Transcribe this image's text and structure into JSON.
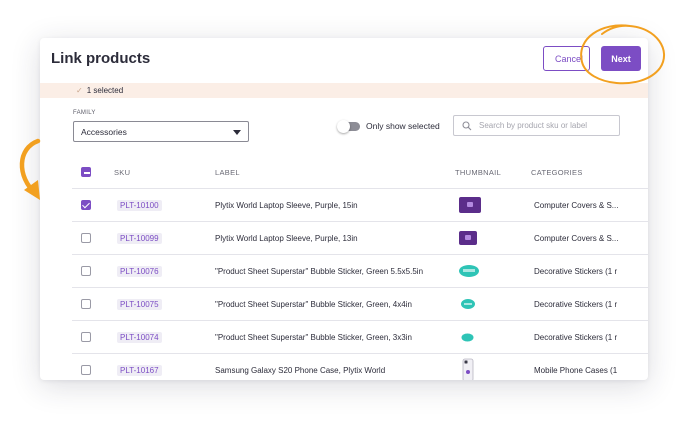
{
  "modal": {
    "title": "Link products",
    "cancel_label": "Cancel",
    "next_label": "Next",
    "selected_text": "1 selected"
  },
  "filters": {
    "family_label": "FAMILY",
    "family_value": "Accessories",
    "toggle_label": "Only show selected",
    "toggle_on": false,
    "search_placeholder": "Search by product sku or label"
  },
  "table": {
    "columns": [
      "SKU",
      "LABEL",
      "THUMBNAIL",
      "CATEGORIES"
    ],
    "rows": [
      {
        "sku": "PLT-10100",
        "label": "Plytix World Laptop Sleeve, Purple, 15in",
        "category": "Computer Covers & S...",
        "checked": true,
        "thumb": "laptop-sleeve"
      },
      {
        "sku": "PLT-10099",
        "label": "Plytix World Laptop Sleeve, Purple, 13in",
        "category": "Computer Covers & S...",
        "checked": false,
        "thumb": "laptop-sleeve"
      },
      {
        "sku": "PLT-10076",
        "label": "\"Product Sheet Superstar\" Bubble Sticker, Green 5.5x5.5in",
        "category": "Decorative Stickers (1 r",
        "checked": false,
        "thumb": "bubble-sticker"
      },
      {
        "sku": "PLT-10075",
        "label": "\"Product Sheet Superstar\" Bubble Sticker, Green, 4x4in",
        "category": "Decorative Stickers (1 r",
        "checked": false,
        "thumb": "bubble-sticker"
      },
      {
        "sku": "PLT-10074",
        "label": "\"Product Sheet Superstar\" Bubble Sticker, Green, 3x3in",
        "category": "Decorative Stickers (1 r",
        "checked": false,
        "thumb": "bubble-sticker"
      },
      {
        "sku": "PLT-10167",
        "label": "Samsung Galaxy S20 Phone Case, Plytix World",
        "category": "Mobile Phone Cases (1",
        "checked": false,
        "thumb": "phone-case"
      }
    ]
  },
  "colors": {
    "accent": "#7c4dc4",
    "selected_bar": "#fbeee6",
    "annotation": "#f2a020",
    "sticker": "#2ec4b6"
  }
}
